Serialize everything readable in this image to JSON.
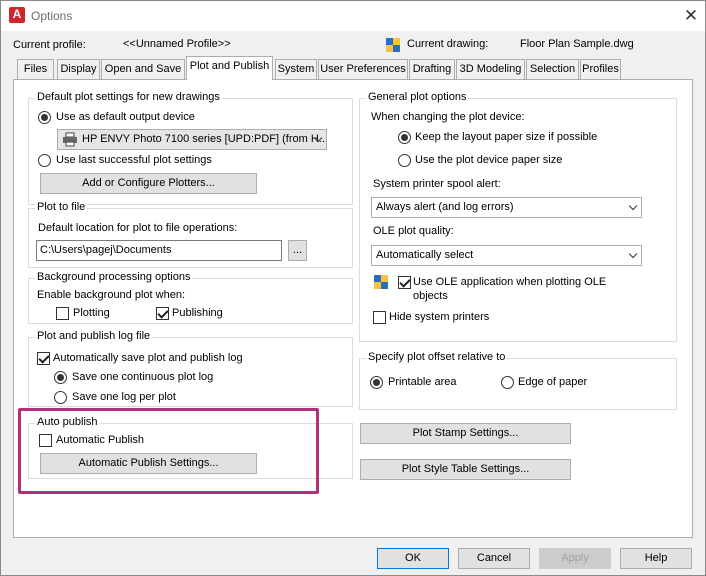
{
  "window": {
    "title": "Options",
    "app_icon_letter": "A",
    "close_symbol": "✕"
  },
  "profile": {
    "current_profile_label": "Current profile:",
    "current_profile_value": "<<Unnamed Profile>>",
    "current_drawing_label": "Current drawing:",
    "current_drawing_value": "Floor Plan Sample.dwg"
  },
  "tabs": [
    "Files",
    "Display",
    "Open and Save",
    "Plot and Publish",
    "System",
    "User Preferences",
    "Drafting",
    "3D Modeling",
    "Selection",
    "Profiles"
  ],
  "active_tab": "Plot and Publish",
  "default_plot": {
    "title": "Default plot settings for new drawings",
    "use_default_device": "Use as default output device",
    "device_value": "HP ENVY Photo 7100 series [UPD:PDF] (from H...",
    "use_last": "Use last successful plot settings",
    "add_plotters_button": "Add or Configure Plotters..."
  },
  "plot_to_file": {
    "title": "Plot to file",
    "label": "Default location for plot to file operations:",
    "path_value": "C:\\Users\\pagej\\Documents",
    "browse_button": "..."
  },
  "background": {
    "title": "Background processing options",
    "enable_label": "Enable background plot when:",
    "plotting": "Plotting",
    "publishing": "Publishing"
  },
  "log": {
    "title": "Plot and publish log file",
    "auto_save": "Automatically save plot and publish log",
    "continuous": "Save one continuous plot log",
    "per_plot": "Save one log per plot"
  },
  "auto_publish": {
    "title": "Auto publish",
    "checkbox": "Automatic Publish",
    "settings_button": "Automatic Publish Settings..."
  },
  "general": {
    "title": "General plot options",
    "changing_label": "When changing the plot device:",
    "keep_layout": "Keep the layout paper size if possible",
    "use_device_size": "Use the plot device paper size",
    "spool_label": "System printer spool alert:",
    "spool_value": "Always alert (and log errors)",
    "ole_label": "OLE plot quality:",
    "ole_value": "Automatically select",
    "use_ole_line1": "Use OLE application when plotting OLE",
    "use_ole_line2": "objects",
    "hide_printers": "Hide system printers"
  },
  "offset": {
    "title": "Specify plot offset relative to",
    "printable": "Printable area",
    "edge": "Edge of paper"
  },
  "stamp_button": "Plot Stamp Settings...",
  "style_button": "Plot Style Table Settings...",
  "footer": {
    "ok": "OK",
    "cancel": "Cancel",
    "apply": "Apply",
    "help": "Help"
  },
  "colors": {
    "highlight": "#b0307a",
    "accent": "#0078d7",
    "app_icon": "#d1252e"
  }
}
